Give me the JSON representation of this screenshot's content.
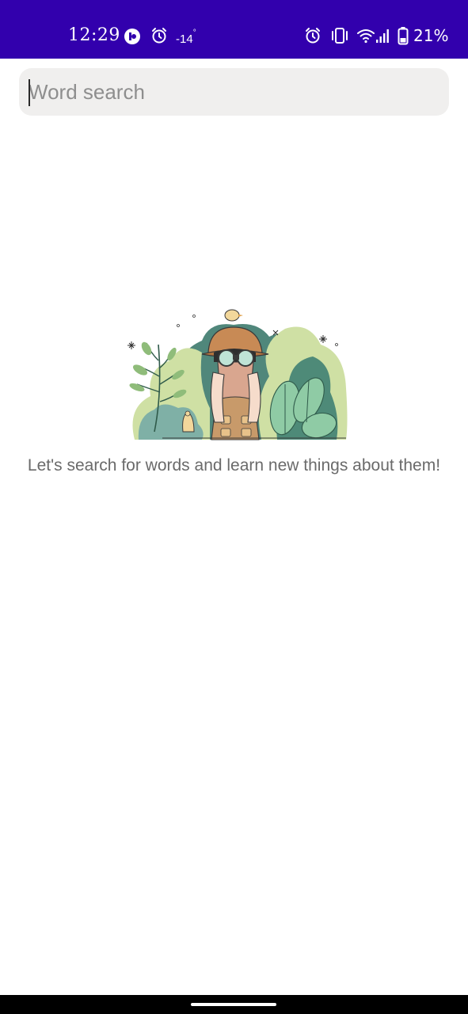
{
  "status_bar": {
    "time": "12:29",
    "temperature": "-14",
    "degree": "°",
    "battery_percent": "21%",
    "background": "#3200ad",
    "icons": [
      "app-notification-icon",
      "alarm-icon",
      "alarm-icon",
      "vibrate-icon",
      "wifi-icon",
      "cell-signal-icon",
      "battery-icon"
    ]
  },
  "search": {
    "placeholder": "Word search",
    "value": ""
  },
  "empty_state": {
    "illustration": "explorer-with-binoculars-illustration",
    "message": "Let's search for words and learn new things about them!"
  },
  "colors": {
    "accent": "#3200ad",
    "search_background": "#f0efee",
    "message_text": "#6a6a6a"
  }
}
